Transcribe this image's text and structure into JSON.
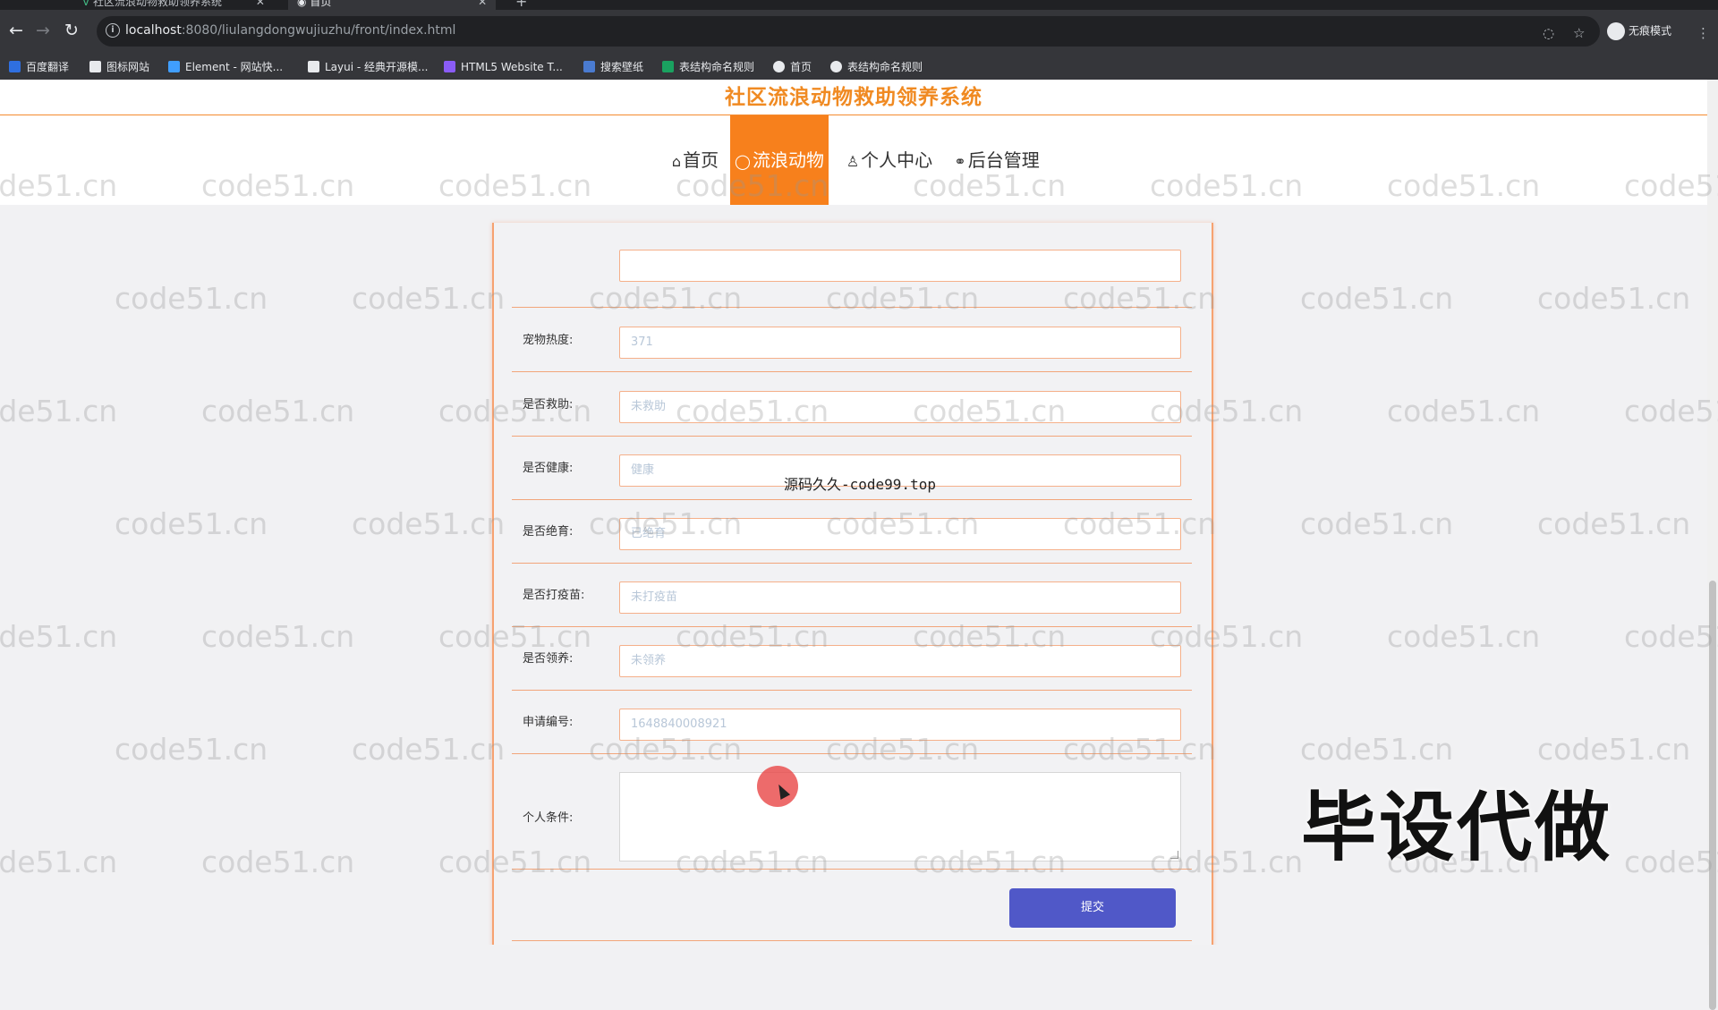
{
  "browser": {
    "tabs": [
      {
        "title": "社区流浪动物救助领养系统"
      },
      {
        "title": "首页"
      }
    ],
    "url_host": "localhost",
    "url_rest": ":8080/liulangdongwujiuzhu/front/index.html",
    "profile_label": "无痕模式",
    "bookmarks": [
      {
        "label": "百度翻译",
        "color": "#2f6fe0"
      },
      {
        "label": "图标网站",
        "color": "#ffffff"
      },
      {
        "label": "Element - 网站快...",
        "color": "#409eff"
      },
      {
        "label": "Layui - 经典开源模...",
        "color": "#ffffff"
      },
      {
        "label": "HTML5 Website T...",
        "color": "#8a5cf6"
      },
      {
        "label": "搜索壁纸",
        "color": "#4a7bd0"
      },
      {
        "label": "表结构命名规则",
        "color": "#1aa260"
      },
      {
        "label": "首页",
        "color": "#e8eaed"
      },
      {
        "label": "表结构命名规则",
        "color": "#e8eaed"
      }
    ]
  },
  "site": {
    "title": "社区流浪动物救助领养系统",
    "nav": [
      {
        "label": "首页",
        "icon": "home-icon",
        "glyph": "⌂"
      },
      {
        "label": "流浪动物",
        "icon": "paw-icon",
        "glyph": "◯"
      },
      {
        "label": "个人中心",
        "icon": "user-icon",
        "glyph": "♙"
      },
      {
        "label": "后台管理",
        "icon": "link-icon",
        "glyph": "⚭"
      }
    ]
  },
  "form": {
    "fields": [
      {
        "label": "宠物热度:",
        "value": "371"
      },
      {
        "label": "是否救助:",
        "value": "未救助"
      },
      {
        "label": "是否健康:",
        "value": "健康"
      },
      {
        "label": "是否绝育:",
        "value": "已绝育"
      },
      {
        "label": "是否打疫苗:",
        "value": "未打疫苗"
      },
      {
        "label": "是否领养:",
        "value": "未领养"
      },
      {
        "label": "申请编号:",
        "value": "1648840008921"
      }
    ],
    "textarea_label": "个人条件:",
    "submit_label": "提交"
  },
  "overlays": {
    "mid_text": "源码久久-code99.top",
    "big_text": "毕设代做",
    "watermark_text": "code51.cn"
  },
  "colors": {
    "accent_orange": "#f7801c",
    "submit_blue": "#5058c8"
  }
}
